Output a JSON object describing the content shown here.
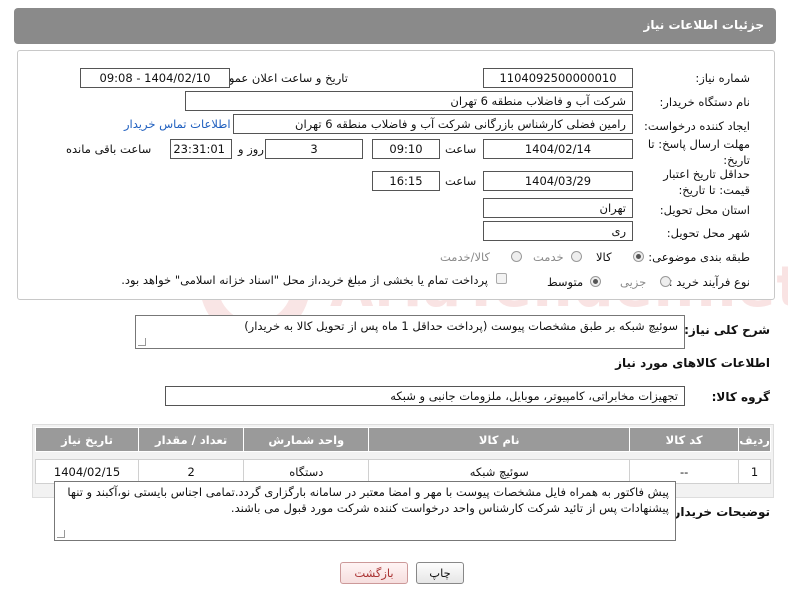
{
  "header": {
    "title": "جزئیات اطلاعات نیاز"
  },
  "form": {
    "need_number_label": "شماره نیاز:",
    "need_number": "1104092500000010",
    "announce_label": "تاریخ و ساعت اعلان عمومی:",
    "announce_value": "1404/02/10 - 09:08",
    "buyer_org_label": "نام دستگاه خریدار:",
    "buyer_org": "شرکت آب و فاضلاب منطقه 6 تهران",
    "creator_label": "ایجاد کننده درخواست:",
    "creator": "رامین  فضلی کارشناس بازرگانی شرکت آب و فاضلاب منطقه 6 تهران",
    "buyer_contact_link": "اطلاعات تماس خریدار",
    "reply_deadline_label": "مهلت ارسال پاسخ: تا تاریخ:",
    "reply_date": "1404/02/14",
    "time_label": "ساعت",
    "reply_time": "09:10",
    "days_value": "3",
    "days_label": "روز و",
    "remaining_time": "23:31:01",
    "remaining_label": "ساعت باقی مانده",
    "price_validity_label": "حداقل تاریخ اعتبار قیمت: تا تاریخ:",
    "price_date": "1404/03/29",
    "price_time": "16:15",
    "province_label": "استان محل تحویل:",
    "province": "تهران",
    "city_label": "شهر محل تحویل:",
    "city": "ری",
    "category_label": "طبقه بندی موضوعی:",
    "category_options": [
      "کالا",
      "خدمت",
      "کالا/خدمت"
    ],
    "process_label": "نوع فرآیند خرید :",
    "process_options": [
      "جزیی",
      "متوسط"
    ],
    "payment_note": "پرداخت تمام یا بخشی از مبلغ خرید،از محل \"اسناد خزانه اسلامی\" خواهد بود."
  },
  "description": {
    "label": "شرح کلی نیاز:",
    "text": "سوئیچ شبکه بر طبق مشخصات پیوست (پرداخت حداقل 1 ماه پس از تحویل کالا به خریدار)"
  },
  "goods": {
    "section_title": "اطلاعات کالاهای مورد نیاز",
    "group_label": "گروه کالا:",
    "group_value": "تجهیزات مخابراتی، کامپیوتر، موبایل، ملزومات جانبی و شبکه",
    "table": {
      "headers": [
        "ردیف",
        "کد کالا",
        "نام کالا",
        "واحد شمارش",
        "تعداد / مقدار",
        "تاریخ نیاز"
      ],
      "rows": [
        [
          "1",
          "--",
          "سوئیچ شبکه",
          "دستگاه",
          "2",
          "1404/02/15"
        ]
      ]
    }
  },
  "buyer_notes": {
    "label": "توضیحات خریدار:",
    "text": "پیش فاکتور به همراه فایل مشخصات پیوست با مهر و امضا معتبر در سامانه بارگزاری گردد.تمامی اجناس بایستی نو،آکبند و تنها پیشنهادات پس از تائید شرکت کارشناس واحد درخواست کننده شرکت مورد قبول می باشند."
  },
  "buttons": {
    "print": "چاپ",
    "back": "بازگشت"
  },
  "watermark": {
    "text": "AriaTender.net"
  }
}
